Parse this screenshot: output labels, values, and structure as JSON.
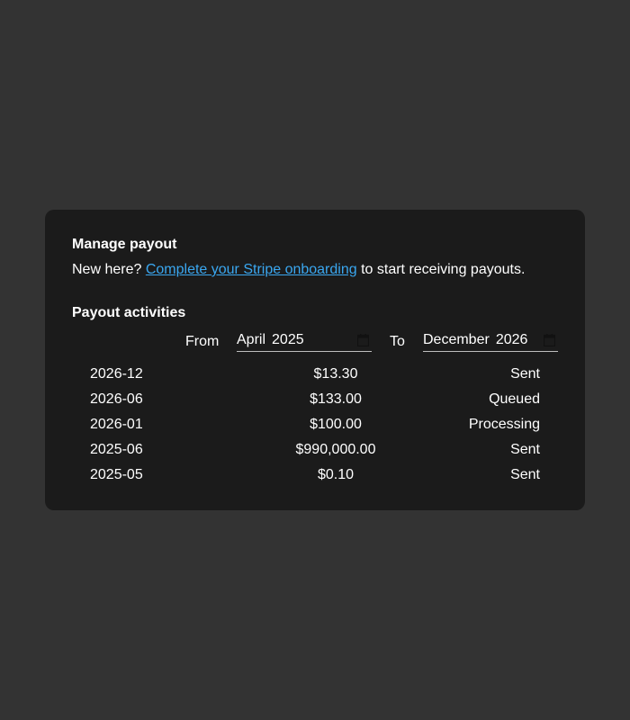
{
  "payout": {
    "title": "Manage payout",
    "intro_prefix": "New here?",
    "onboarding_link": "Complete your Stripe onboarding",
    "intro_suffix": "to start receiving payouts."
  },
  "activities": {
    "title": "Payout activities",
    "from_label": "From",
    "from_month": "April",
    "from_year": "2025",
    "to_label": "To",
    "to_month": "December",
    "to_year": "2026",
    "rows": [
      {
        "date": "2026-12",
        "amount": "$13.30",
        "status": "Sent"
      },
      {
        "date": "2026-06",
        "amount": "$133.00",
        "status": "Queued"
      },
      {
        "date": "2026-01",
        "amount": "$100.00",
        "status": "Processing"
      },
      {
        "date": "2025-06",
        "amount": "$990,000.00",
        "status": "Sent"
      },
      {
        "date": "2025-05",
        "amount": "$0.10",
        "status": "Sent"
      }
    ]
  },
  "colors": {
    "page_background": "#333333",
    "card_background": "#1b1b1b",
    "link": "#3aa7f0"
  }
}
